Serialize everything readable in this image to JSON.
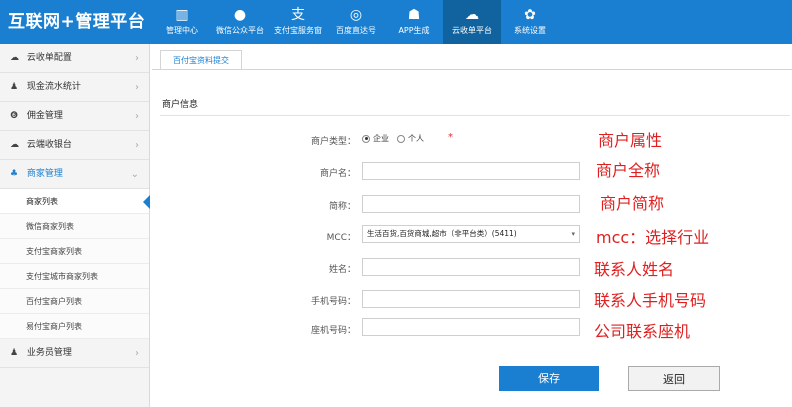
{
  "brand": "互联网+管理平台",
  "nav": [
    {
      "icon": "wallet-icon",
      "glyph": "▥",
      "label": "管理中心"
    },
    {
      "icon": "wechat-icon",
      "glyph": "●",
      "label": "微信公众平台"
    },
    {
      "icon": "alipay-icon",
      "glyph": "支",
      "label": "支付宝服务窗"
    },
    {
      "icon": "baidu-icon",
      "glyph": "◎",
      "label": "百度直达号"
    },
    {
      "icon": "android-icon",
      "glyph": "☗",
      "label": "APP生成"
    },
    {
      "icon": "cloud-icon",
      "glyph": "☁",
      "label": "云收单平台"
    },
    {
      "icon": "gear-icon",
      "glyph": "✿",
      "label": "系统设置"
    }
  ],
  "sidebar": {
    "items": [
      {
        "icon": "cloud-icon",
        "glyph": "☁",
        "label": "云收单配置"
      },
      {
        "icon": "money-bag-icon",
        "glyph": "♟",
        "label": "现金流水统计"
      },
      {
        "icon": "coin-icon",
        "glyph": "❻",
        "label": "佣金管理"
      },
      {
        "icon": "cashier-icon",
        "glyph": "☁",
        "label": "云端收银台"
      },
      {
        "icon": "users-icon",
        "glyph": "♣",
        "label": "商家管理"
      }
    ],
    "sub_items": [
      "商家列表",
      "微信商家列表",
      "支付宝商家列表",
      "支付宝城市商家列表",
      "百付宝商户列表",
      "易付宝商户列表"
    ],
    "bottom_item": {
      "icon": "person-icon",
      "glyph": "♟",
      "label": "业务员管理"
    }
  },
  "tab_label": "百付宝资料提交",
  "section_title": "商户信息",
  "form": {
    "type_label": "商户类型：",
    "type_options": [
      "企业",
      "个人"
    ],
    "name_label": "商户名：",
    "short_label": "简称：",
    "mcc_label": "MCC：",
    "mcc_value": "生活百货,百货商城,超市（非平台类）(5411)",
    "contact_label": "姓名：",
    "phone_label": "手机号码：",
    "landline_label": "座机号码："
  },
  "annotations": [
    "商户属性",
    "商户全称",
    "商户简称",
    "mcc：选择行业",
    "联系人姓名",
    "联系人手机号码",
    "公司联系座机"
  ],
  "buttons": {
    "save": "保存",
    "back": "返回"
  }
}
